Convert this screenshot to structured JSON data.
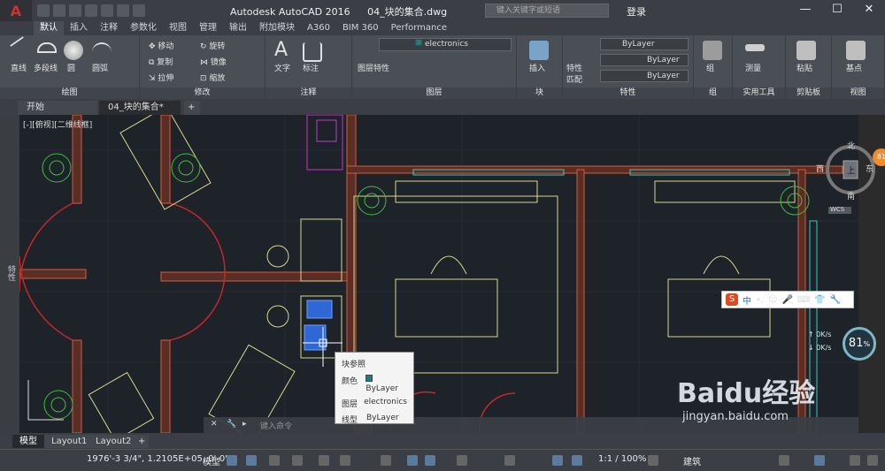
{
  "titlebar": {
    "app_name": "Autodesk AutoCAD 2016",
    "file_name": "04_块的集合.dwg",
    "search_placeholder": "键入关键字或短语",
    "login_label": "登录",
    "help_label": "?"
  },
  "ribbon_tabs": [
    "默认",
    "插入",
    "注释",
    "参数化",
    "视图",
    "管理",
    "输出",
    "附加模块",
    "A360",
    "BIM 360",
    "Performance"
  ],
  "panels": {
    "draw": {
      "title": "绘图",
      "tools": [
        "直线",
        "多段线",
        "圆",
        "圆弧"
      ]
    },
    "modify": {
      "title": "修改",
      "tools": [
        "移动",
        "旋转",
        "复制",
        "镜像",
        "拉伸",
        "缩放"
      ]
    },
    "annotation": {
      "title": "注释",
      "tools": [
        "文字",
        "标注"
      ]
    },
    "layers": {
      "title": "图层",
      "layer_props": "图层特性",
      "current_layer": "electronics"
    },
    "block": {
      "title": "块",
      "insert": "插入"
    },
    "properties": {
      "title": "特性",
      "match": "特性匹配",
      "color": "ByLayer",
      "linetype": "ByLayer",
      "lineweight": "ByLayer"
    },
    "groups": {
      "title": "组",
      "group": "组"
    },
    "utilities": {
      "title": "实用工具",
      "measure": "测量"
    },
    "clipboard": {
      "title": "剪贴板",
      "paste": "粘贴"
    },
    "view": {
      "title": "视图",
      "base": "基点"
    }
  },
  "doc_tabs": {
    "start": "开始",
    "current": "04_块的集合*",
    "add": "+"
  },
  "viewport_label": "[-][俯视][二维线框]",
  "side_palette": "特性",
  "navcube": {
    "north": "北",
    "south": "南",
    "west": "西",
    "east": "东",
    "face": "上",
    "wcs": "WCS"
  },
  "tooltip": {
    "title": "块参照",
    "rows": [
      {
        "key": "颜色",
        "value": "ByLayer"
      },
      {
        "key": "图层",
        "value": "electronics"
      },
      {
        "key": "线型",
        "value": "ByLayer"
      }
    ]
  },
  "command_placeholder": "键入命令",
  "layout_tabs": [
    "模型",
    "Layout1",
    "Layout2"
  ],
  "status": {
    "coordinates": "1976'-3 3/4\", 1.2105E+05, 0'-0\"",
    "model": "模型",
    "scale": "1:1 / 100%",
    "workspace": "建筑"
  },
  "overlay": {
    "progress": "81",
    "progress_unit": "%",
    "speed_up": "0K/s",
    "speed_down": "0K/s",
    "badge": "81",
    "ime_lang": "中",
    "watermark_big": "Baidu经验",
    "watermark_small": "jingyan.baidu.com"
  },
  "colors": {
    "electronics": "#1a7e80",
    "accent": "#d32f2f"
  }
}
